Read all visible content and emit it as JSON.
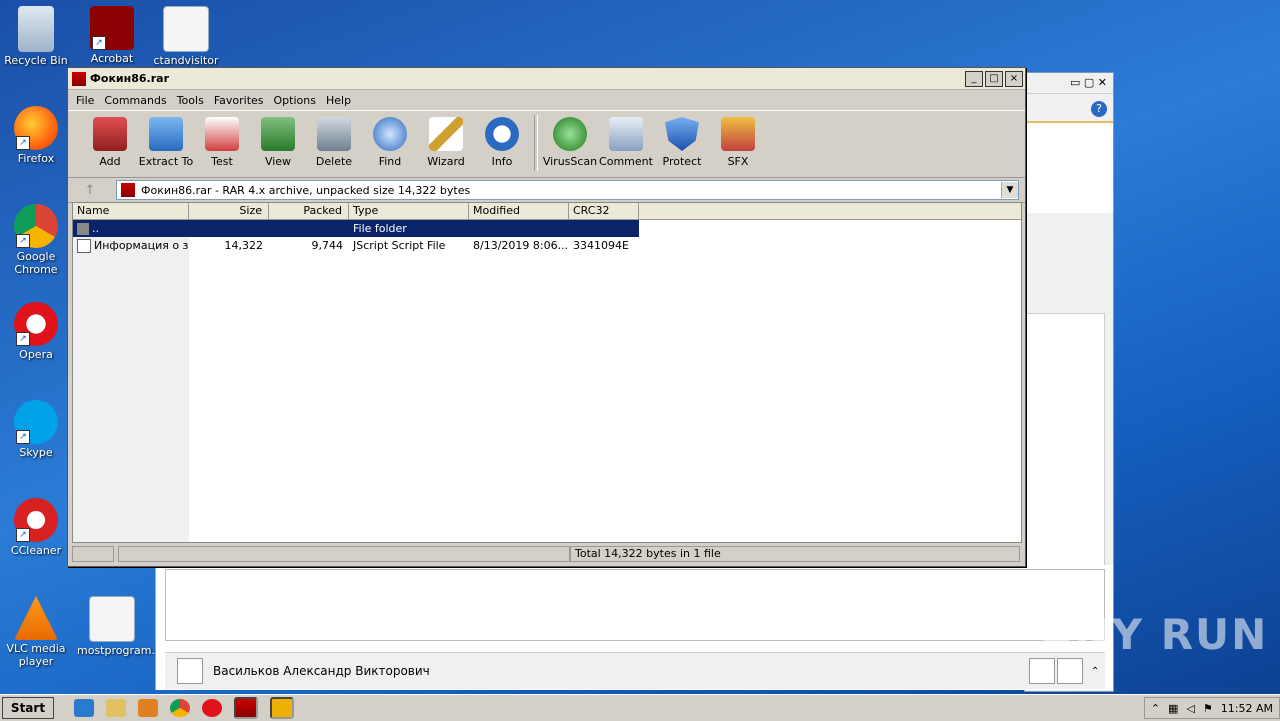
{
  "desktop": {
    "icons": [
      {
        "label": "Recycle Bin"
      },
      {
        "label": "Acrobat"
      },
      {
        "label": "ctandvisitor"
      },
      {
        "label": "Firefox"
      },
      {
        "label": "Google Chrome"
      },
      {
        "label": "Opera"
      },
      {
        "label": "Skype"
      },
      {
        "label": "CCleaner"
      },
      {
        "label": "VLC media player"
      },
      {
        "label": "mostprogram..."
      }
    ]
  },
  "window": {
    "title": "Фокин86.rar",
    "controls": {
      "minimize": "_",
      "maximize": "□",
      "close": "×"
    }
  },
  "menu": [
    "File",
    "Commands",
    "Tools",
    "Favorites",
    "Options",
    "Help"
  ],
  "toolbar": [
    {
      "label": "Add",
      "icon": "add-icon",
      "color": "#b03030"
    },
    {
      "label": "Extract To",
      "icon": "extract-to-icon",
      "color": "#3a7fd0"
    },
    {
      "label": "Test",
      "icon": "test-icon",
      "color": "#c83a3a"
    },
    {
      "label": "View",
      "icon": "view-icon",
      "color": "#3a8a3a"
    },
    {
      "label": "Delete",
      "icon": "delete-icon",
      "color": "#8090a0"
    },
    {
      "label": "Find",
      "icon": "find-icon",
      "color": "#2a6ac0"
    },
    {
      "label": "Wizard",
      "icon": "wizard-icon",
      "color": "#d0a030"
    },
    {
      "label": "Info",
      "icon": "info-icon",
      "color": "#2a6ac0"
    },
    {
      "label": "VirusScan",
      "icon": "virusscan-icon",
      "color": "#2a9a2a"
    },
    {
      "label": "Comment",
      "icon": "comment-icon",
      "color": "#7090b0"
    },
    {
      "label": "Protect",
      "icon": "protect-icon",
      "color": "#2a6ad0"
    },
    {
      "label": "SFX",
      "icon": "sfx-icon",
      "color": "#c04040"
    }
  ],
  "address": {
    "text": "Фокин86.rar - RAR 4.x archive, unpacked size 14,322 bytes"
  },
  "columns": [
    "Name",
    "Size",
    "Packed",
    "Type",
    "Modified",
    "CRC32"
  ],
  "rows": [
    {
      "name": "..",
      "size": "",
      "packed": "",
      "type": "File folder",
      "modified": "",
      "crc": ""
    },
    {
      "name": "Информация о з...",
      "size": "14,322",
      "packed": "9,744",
      "type": "JScript Script File",
      "modified": "8/13/2019 8:06...",
      "crc": "3341094E"
    }
  ],
  "status": {
    "total": "Total 14,322 bytes in 1 file"
  },
  "contact": {
    "name": "Васильков Александр Викторович"
  },
  "taskbar": {
    "start": "Start",
    "clock": "11:52 AM"
  },
  "watermark": "ANY RUN"
}
